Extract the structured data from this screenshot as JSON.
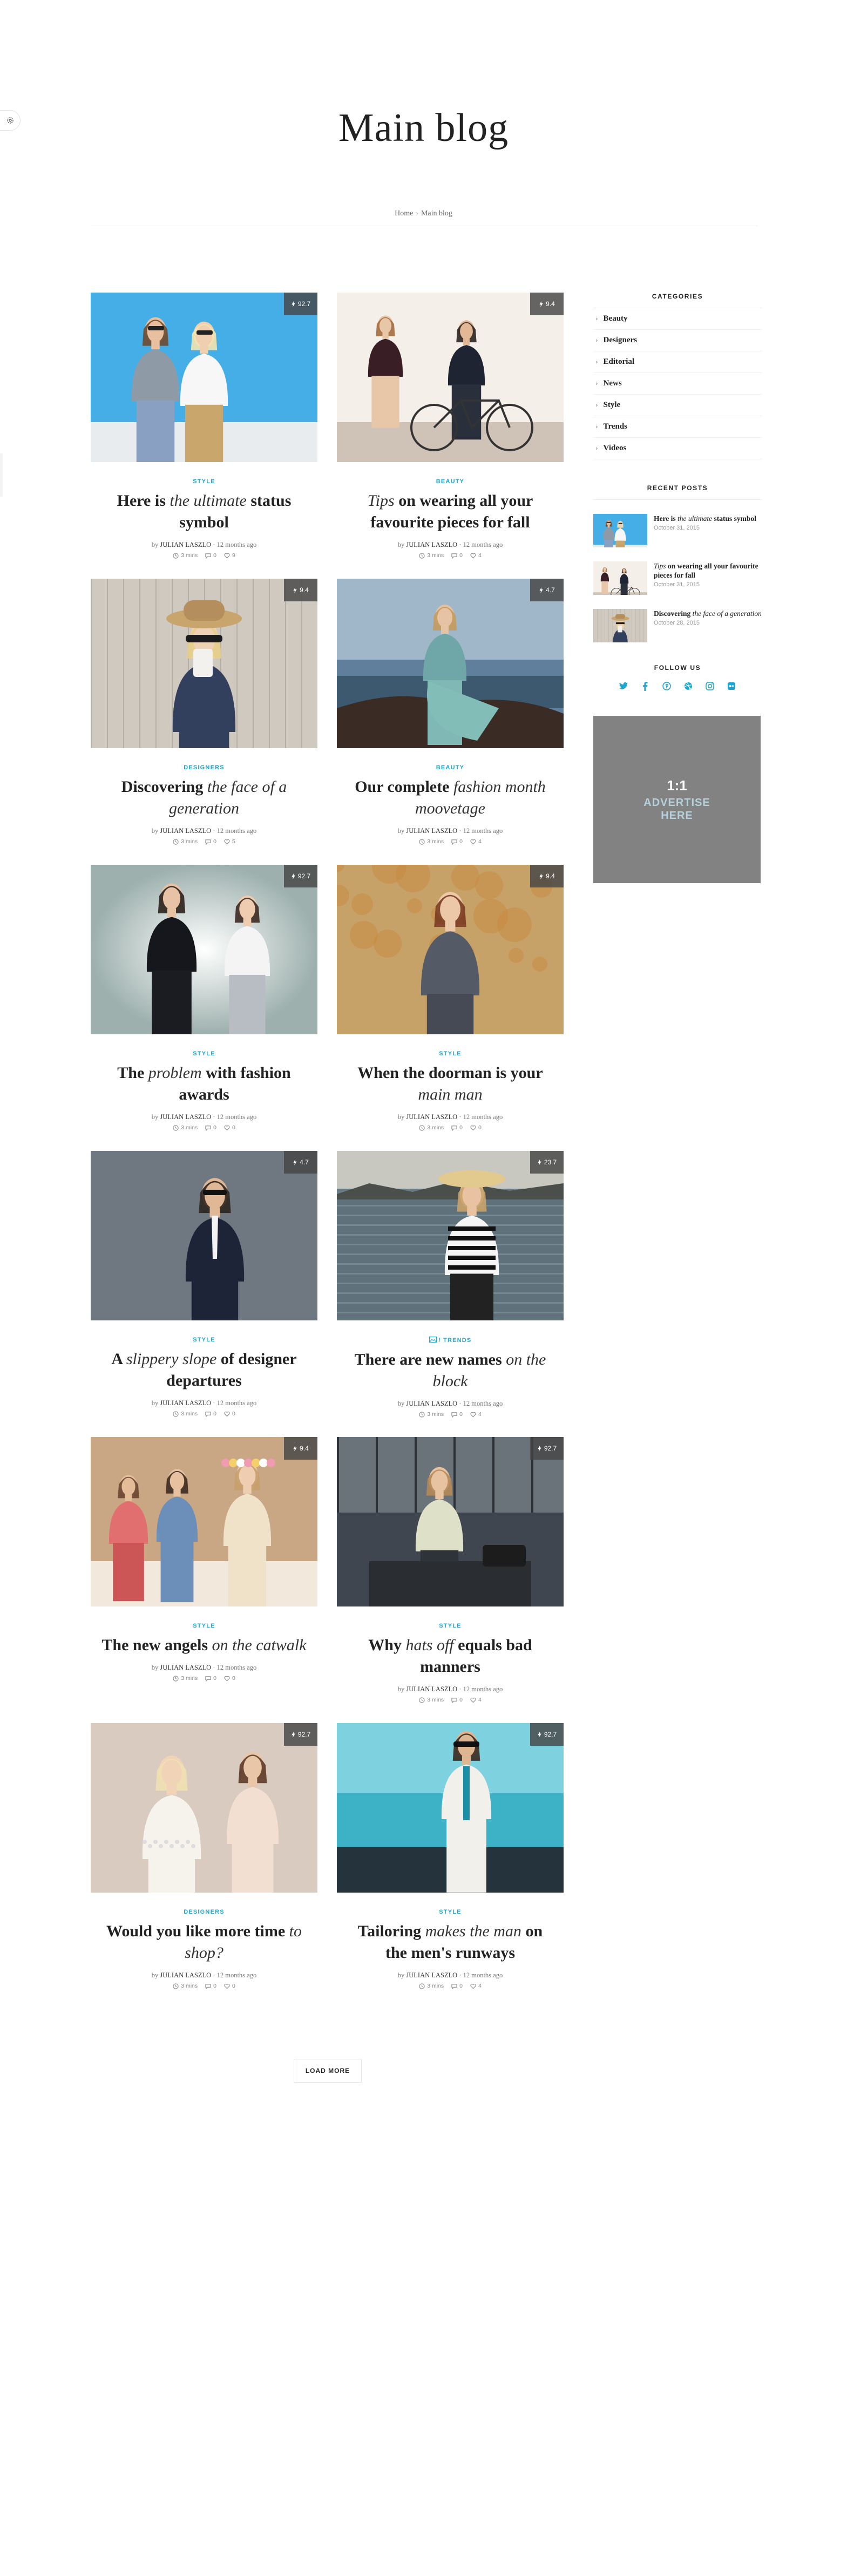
{
  "page": {
    "title": "Main blog",
    "breadcrumb": {
      "home": "Home",
      "separator": "›",
      "current": "Main blog"
    }
  },
  "colors": {
    "accent": "#1ea6cf",
    "ad_background": "#828282",
    "badge": "#474747"
  },
  "posts": [
    {
      "category": "STYLE",
      "badge": "92.7",
      "title": [
        [
          "n",
          "Here is "
        ],
        [
          "i",
          "the ultimate"
        ],
        [
          "b",
          " status symbol"
        ]
      ],
      "by": "by",
      "author": "JULIAN LASZLO",
      "date": "12 months ago",
      "views": "3 mins",
      "comments": "0",
      "likes": "9"
    },
    {
      "category": "BEAUTY",
      "badge": "9.4",
      "title": [
        [
          "i",
          "Tips"
        ],
        [
          "n",
          " on wearing "
        ],
        [
          "b",
          "all your favourite pieces"
        ],
        [
          "n",
          " for fall"
        ]
      ],
      "by": "by",
      "author": "JULIAN LASZLO",
      "date": "12 months ago",
      "views": "3 mins",
      "comments": "0",
      "likes": "4"
    },
    {
      "category": "DESIGNERS",
      "badge": "9.4",
      "title": [
        [
          "b",
          "Discovering"
        ],
        [
          "i",
          " the face of a generation"
        ]
      ],
      "by": "by",
      "author": "JULIAN LASZLO",
      "date": "12 months ago",
      "views": "3 mins",
      "comments": "0",
      "likes": "5"
    },
    {
      "category": "BEAUTY",
      "badge": "4.7",
      "title": [
        [
          "n",
          "Our "
        ],
        [
          "b",
          "complete"
        ],
        [
          "i",
          " fashion month moovetage"
        ]
      ],
      "by": "by",
      "author": "JULIAN LASZLO",
      "date": "12 months ago",
      "views": "3 mins",
      "comments": "0",
      "likes": "4"
    },
    {
      "category": "STYLE",
      "badge": "92.7",
      "title": [
        [
          "n",
          "The "
        ],
        [
          "i",
          "problem"
        ],
        [
          "n",
          " with "
        ],
        [
          "b",
          "fashion awards"
        ]
      ],
      "by": "by",
      "author": "JULIAN LASZLO",
      "date": "12 months ago",
      "views": "3 mins",
      "comments": "0",
      "likes": "0"
    },
    {
      "category": "STYLE",
      "badge": "9.4",
      "title": [
        [
          "n",
          "When the "
        ],
        [
          "b",
          "doorman"
        ],
        [
          "n",
          " is your "
        ],
        [
          "i",
          "main man"
        ]
      ],
      "by": "by",
      "author": "JULIAN LASZLO",
      "date": "12 months ago",
      "views": "3 mins",
      "comments": "0",
      "likes": "0"
    },
    {
      "category": "STYLE",
      "badge": "4.7",
      "title": [
        [
          "n",
          "A "
        ],
        [
          "i",
          "slippery slope"
        ],
        [
          "n",
          " of "
        ],
        [
          "b",
          "designer departures"
        ]
      ],
      "by": "by",
      "author": "JULIAN LASZLO",
      "date": "12 months ago",
      "views": "3 mins",
      "comments": "0",
      "likes": "0"
    },
    {
      "category": "/ TRENDS",
      "badge": "23.7",
      "title": [
        [
          "n",
          "There are "
        ],
        [
          "b",
          "new names"
        ],
        [
          "i",
          " on the block"
        ]
      ],
      "by": "by",
      "author": "JULIAN LASZLO",
      "date": "12 months ago",
      "views": "3 mins",
      "comments": "0",
      "likes": "4"
    },
    {
      "category": "STYLE",
      "badge": "9.4",
      "title": [
        [
          "n",
          "The new "
        ],
        [
          "b",
          "angels"
        ],
        [
          "i",
          " on the catwalk"
        ]
      ],
      "by": "by",
      "author": "JULIAN LASZLO",
      "date": "12 months ago",
      "views": "3 mins",
      "comments": "0",
      "likes": "0"
    },
    {
      "category": "STYLE",
      "badge": "92.7",
      "title": [
        [
          "n",
          "Why "
        ],
        [
          "i",
          "hats off"
        ],
        [
          "n",
          " equals "
        ],
        [
          "b",
          "bad manners"
        ]
      ],
      "by": "by",
      "author": "JULIAN LASZLO",
      "date": "12 months ago",
      "views": "3 mins",
      "comments": "0",
      "likes": "4"
    },
    {
      "category": "DESIGNERS",
      "badge": "92.7",
      "title": [
        [
          "n",
          "Would you like "
        ],
        [
          "b",
          "more time"
        ],
        [
          "i",
          " to shop?"
        ]
      ],
      "by": "by",
      "author": "JULIAN LASZLO",
      "date": "12 months ago",
      "views": "3 mins",
      "comments": "0",
      "likes": "0"
    },
    {
      "category": "STYLE",
      "badge": "92.7",
      "title": [
        [
          "b",
          "Tailoring"
        ],
        [
          "i",
          " makes the man"
        ],
        [
          "n",
          " on the "
        ],
        [
          "b",
          "men's runways"
        ]
      ],
      "by": "by",
      "author": "JULIAN LASZLO",
      "date": "12 months ago",
      "views": "3 mins",
      "comments": "0",
      "likes": "4"
    }
  ],
  "load_more": "LOAD MORE",
  "sidebar": {
    "categories_title": "CATEGORIES",
    "categories": [
      "Beauty",
      "Designers",
      "Editorial",
      "News",
      "Style",
      "Trends",
      "Videos"
    ],
    "recent_title": "RECENT POSTS",
    "recent": [
      {
        "title": [
          [
            "b",
            "Here is "
          ],
          [
            "i",
            "the ultimate"
          ],
          [
            "b",
            " status symbol"
          ]
        ],
        "date": "October 31, 2015"
      },
      {
        "title": [
          [
            "i",
            "Tips"
          ],
          [
            "b",
            " on wearing all your favourite pieces for fall"
          ]
        ],
        "date": "October 31, 2015"
      },
      {
        "title": [
          [
            "b",
            "Discovering"
          ],
          [
            "i",
            " the face of a generation"
          ]
        ],
        "date": "October 28, 2015"
      }
    ],
    "follow_title": "FOLLOW US",
    "social_icons": [
      "twitter-icon",
      "facebook-icon",
      "pinterest-icon",
      "dribbble-icon",
      "instagram-icon",
      "flickr-icon"
    ],
    "ad": {
      "ratio": "1:1",
      "line1": "ADVERTISE",
      "line2": "HERE"
    }
  }
}
